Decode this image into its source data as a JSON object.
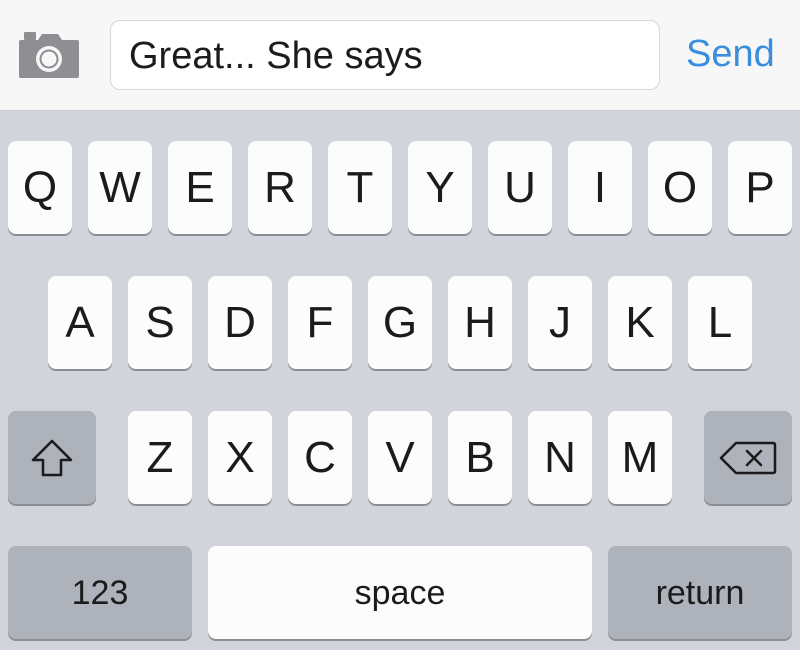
{
  "input_bar": {
    "camera_icon": "camera-icon",
    "message_text": "Great... She says",
    "send_label": "Send",
    "accent_color": "#3a8ede"
  },
  "keyboard": {
    "row1": [
      "Q",
      "W",
      "E",
      "R",
      "T",
      "Y",
      "U",
      "I",
      "O",
      "P"
    ],
    "row2": [
      "A",
      "S",
      "D",
      "F",
      "G",
      "H",
      "J",
      "K",
      "L"
    ],
    "row3": [
      "Z",
      "X",
      "C",
      "V",
      "B",
      "N",
      "M"
    ],
    "shift_icon": "shift-icon",
    "delete_icon": "backspace-icon",
    "numbers_label": "123",
    "space_label": "space",
    "return_label": "return"
  }
}
